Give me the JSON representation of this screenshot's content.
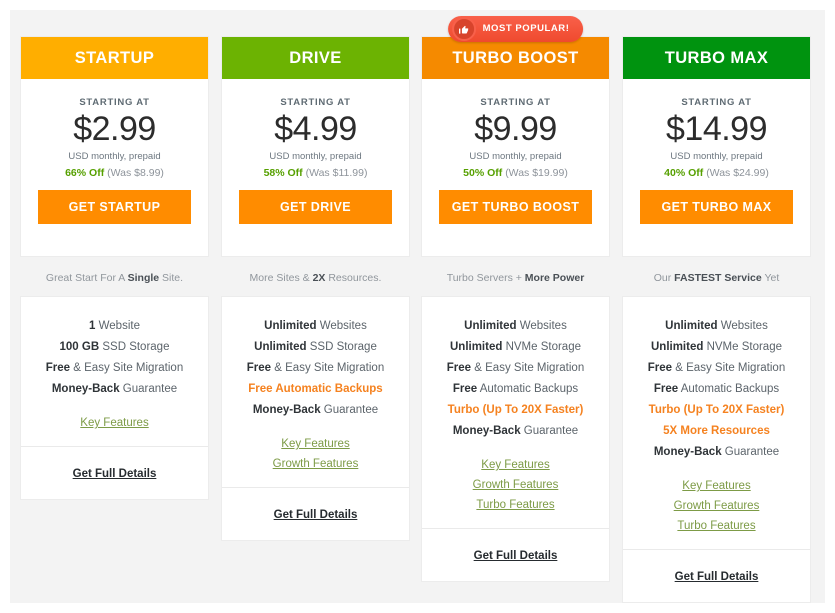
{
  "colors": {
    "page_bg": "#f3f3f3",
    "cta_orange": "#ff8c00",
    "link_green": "#7d9b46",
    "discount_green": "#56a000",
    "highlight_orange": "#f58220",
    "badge_red": "#f4563c"
  },
  "labels": {
    "starting_at": "STARTING AT",
    "terms": "USD monthly, prepaid",
    "details": "Get Full Details"
  },
  "badge": {
    "text": "MOST POPULAR!",
    "icon": "thumbs-up-icon"
  },
  "plans": [
    {
      "name": "STARTUP",
      "header_color": "#ffae00",
      "price": "$2.99",
      "starting_at": "STARTING AT",
      "terms": "USD monthly, prepaid",
      "discount_pct": "66% Off",
      "was": "(Was $8.99)",
      "cta": "GET STARTUP",
      "tagline_pre": "Great Start For A ",
      "tagline_bold": "Single",
      "tagline_post": " Site.",
      "badge": false,
      "features": [
        {
          "bold": "1",
          "rest": " Website",
          "hl": false
        },
        {
          "bold": "100 GB",
          "rest": " SSD Storage",
          "hl": false
        },
        {
          "bold": "Free",
          "rest": " & Easy Site Migration",
          "hl": false
        },
        {
          "bold": "Money-Back",
          "rest": " Guarantee",
          "hl": false
        }
      ],
      "links": [
        "Key Features"
      ],
      "details": "Get Full Details"
    },
    {
      "name": "DRIVE",
      "header_color": "#6cb302",
      "price": "$4.99",
      "starting_at": "STARTING AT",
      "terms": "USD monthly, prepaid",
      "discount_pct": "58% Off",
      "was": "(Was $11.99)",
      "cta": "GET DRIVE",
      "tagline_pre": "More Sites & ",
      "tagline_bold": "2X",
      "tagline_post": " Resources.",
      "badge": false,
      "features": [
        {
          "bold": "Unlimited",
          "rest": " Websites",
          "hl": false
        },
        {
          "bold": "Unlimited",
          "rest": " SSD Storage",
          "hl": false
        },
        {
          "bold": "Free",
          "rest": " & Easy Site Migration",
          "hl": false
        },
        {
          "bold": "Free",
          "rest": " Automatic Backups",
          "hl": true
        },
        {
          "bold": "Money-Back",
          "rest": " Guarantee",
          "hl": false
        }
      ],
      "links": [
        "Key Features",
        "Growth Features"
      ],
      "details": "Get Full Details"
    },
    {
      "name": "TURBO BOOST",
      "header_color": "#f58a00",
      "price": "$9.99",
      "starting_at": "STARTING AT",
      "terms": "USD monthly, prepaid",
      "discount_pct": "50% Off",
      "was": "(Was $19.99)",
      "cta": "GET TURBO BOOST",
      "tagline_pre": "Turbo Servers + ",
      "tagline_bold": "More Power",
      "tagline_post": "",
      "badge": true,
      "features": [
        {
          "bold": "Unlimited",
          "rest": " Websites",
          "hl": false
        },
        {
          "bold": "Unlimited",
          "rest": " NVMe Storage",
          "hl": false
        },
        {
          "bold": "Free",
          "rest": " & Easy Site Migration",
          "hl": false
        },
        {
          "bold": "Free",
          "rest": " Automatic Backups",
          "hl": false
        },
        {
          "bold": "Turbo (Up To 20X Faster)",
          "rest": "",
          "hl": true
        },
        {
          "bold": "Money-Back",
          "rest": " Guarantee",
          "hl": false
        }
      ],
      "links": [
        "Key Features",
        "Growth Features",
        "Turbo Features"
      ],
      "details": "Get Full Details"
    },
    {
      "name": "TURBO MAX",
      "header_color": "#00930f",
      "price": "$14.99",
      "starting_at": "STARTING AT",
      "terms": "USD monthly, prepaid",
      "discount_pct": "40% Off",
      "was": "(Was $24.99)",
      "cta": "GET TURBO MAX",
      "tagline_pre": "Our ",
      "tagline_bold": "FASTEST Service",
      "tagline_post": " Yet",
      "badge": false,
      "features": [
        {
          "bold": "Unlimited",
          "rest": " Websites",
          "hl": false
        },
        {
          "bold": "Unlimited",
          "rest": " NVMe Storage",
          "hl": false
        },
        {
          "bold": "Free",
          "rest": " & Easy Site Migration",
          "hl": false
        },
        {
          "bold": "Free",
          "rest": " Automatic Backups",
          "hl": false
        },
        {
          "bold": "Turbo (Up To 20X Faster)",
          "rest": "",
          "hl": true
        },
        {
          "bold": "5X More Resources",
          "rest": "",
          "hl": true
        },
        {
          "bold": "Money-Back",
          "rest": " Guarantee",
          "hl": false
        }
      ],
      "links": [
        "Key Features",
        "Growth Features",
        "Turbo Features"
      ],
      "details": "Get Full Details"
    }
  ]
}
